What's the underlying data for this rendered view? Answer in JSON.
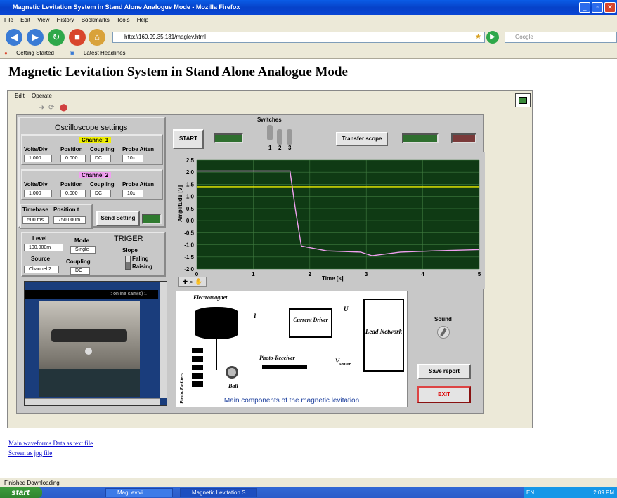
{
  "browser": {
    "window_title": "Magnetic Levitation System in Stand Alone Analogue Mode - Mozilla Firefox",
    "menu": [
      "File",
      "Edit",
      "View",
      "History",
      "Bookmarks",
      "Tools",
      "Help"
    ],
    "url": "http://160.99.35.131/maglev.html",
    "search_placeholder": "Google",
    "bookmarks": [
      "Getting Started",
      "Latest Headlines"
    ],
    "status": "Finished Downloading"
  },
  "page": {
    "heading": "Magnetic Levitation System in Stand Alone Analogue Mode",
    "links": [
      "Main waveforms Data as text file",
      "Screen as jpg file"
    ]
  },
  "vi": {
    "menu": [
      "Edit",
      "Operate"
    ],
    "osc_title": "Oscilloscope settings",
    "ch1": {
      "label": "Channel 1",
      "color": "#f0f000",
      "volts_div": "1.000",
      "position": "0.000",
      "coupling": "DC",
      "probe": "10x"
    },
    "ch2": {
      "label": "Channel 2",
      "color": "#f0a0f0",
      "volts_div": "1.000",
      "position": "0.000",
      "coupling": "DC",
      "probe": "10x"
    },
    "col_labels": {
      "volts": "Volts/Div",
      "position": "Position",
      "coupling": "Coupling",
      "probe": "Probe Atten"
    },
    "timebase": {
      "label": "Timebase",
      "value": "500 ms",
      "pos_label": "Position t",
      "pos_value": "750.000m"
    },
    "send_setting": "Send Setting",
    "trigger": {
      "title": "TRIGER",
      "level_label": "Level",
      "level": "100.000m",
      "mode_label": "Mode",
      "mode": "Single",
      "source_label": "Source",
      "source": "Channel 2",
      "coupling_label": "Coupling",
      "coupling": "DC",
      "slope_label": "Slope",
      "falling": "Faling",
      "raising": "Raising"
    },
    "start": "START",
    "switches_label": "Switches",
    "switch_numbers": [
      "1",
      "2",
      "3"
    ],
    "transfer": "Transfer scope",
    "sound": "Sound",
    "save_report": "Save report",
    "exit": "EXIT",
    "webcam_text": ".: online cam(s) :.",
    "diagram": {
      "electromagnet": "Electromagnet",
      "current_driver": "Current Driver",
      "lead_network": "Lead Network",
      "i": "I",
      "u": "U",
      "photo_receiver": "Photo-Receiver",
      "vsensor": "V",
      "vsensor_sub": "sensor",
      "photo_emitters": "Photo-Emitters",
      "ball": "Ball",
      "caption": "Main components of the magnetic levitation"
    }
  },
  "chart_data": {
    "type": "line",
    "xlabel": "Time [s]",
    "ylabel": "Amplitude [V]",
    "xlim": [
      0,
      5
    ],
    "ylim": [
      -2.0,
      2.5
    ],
    "xticks": [
      "0",
      "1",
      "2",
      "3",
      "4",
      "5"
    ],
    "yticks": [
      "2.5",
      "2.0",
      "1.5",
      "1.0",
      "0.5",
      "0.0",
      "-0.5",
      "-1.0",
      "-1.5",
      "-2.0"
    ],
    "grid": true,
    "series": [
      {
        "color": "#f0f000",
        "x": [
          0,
          1,
          2,
          3,
          4,
          5
        ],
        "y": [
          1.4,
          1.4,
          1.4,
          1.4,
          1.4,
          1.4
        ]
      },
      {
        "color": "#f0a0f0",
        "x": [
          0,
          1.0,
          1.65,
          1.75,
          1.85,
          2.3,
          2.9,
          3.1,
          3.6,
          4.2,
          5
        ],
        "y": [
          2.05,
          2.05,
          2.05,
          0.4,
          -1.05,
          -1.25,
          -1.3,
          -1.45,
          -1.3,
          -1.25,
          -1.2
        ]
      }
    ]
  },
  "taskbar": {
    "start": "start",
    "tasks": [
      "MagLev.vi",
      "Magnetic Levitation S..."
    ],
    "tray": [
      "EN",
      "2:09 PM"
    ]
  }
}
